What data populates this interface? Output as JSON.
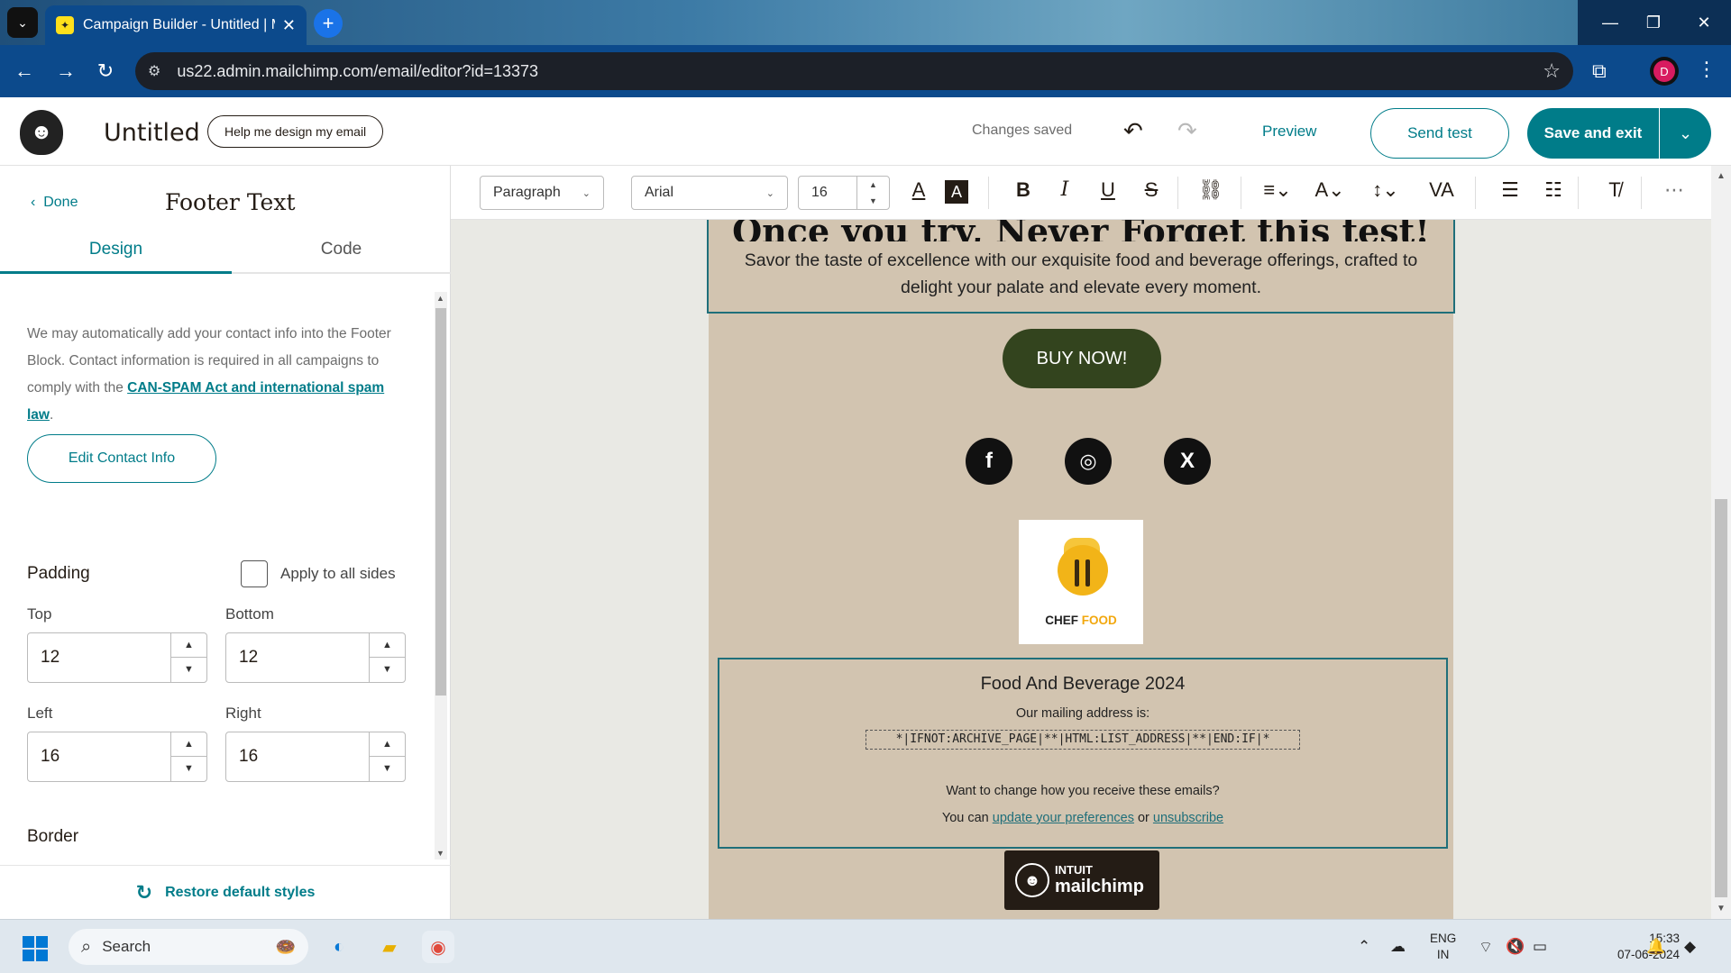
{
  "browser": {
    "tab_title": "Campaign Builder - Untitled | M",
    "favicon": "mailchimp-icon",
    "url": "us22.admin.mailchimp.com/email/editor?id=13373",
    "profile_initial": "D"
  },
  "header": {
    "campaign_title": "Untitled",
    "help_button": "Help me design my email",
    "status": "Changes saved",
    "preview": "Preview",
    "send_test": "Send test",
    "save_exit": "Save and exit"
  },
  "panel": {
    "done": "Done",
    "title": "Footer Text",
    "tabs": [
      {
        "label": "Design",
        "active": true
      },
      {
        "label": "Code",
        "active": false
      }
    ],
    "note_text": "We may automatically add your contact info into the Footer Block. Contact information is required in all campaigns to comply with the ",
    "note_link": "CAN-SPAM Act and international spam law",
    "note_end": ".",
    "edit_contact": "Edit Contact Info",
    "padding_heading": "Padding",
    "apply_all": "Apply to all sides",
    "apply_all_checked": false,
    "padding": {
      "top_label": "Top",
      "top": "12",
      "bottom_label": "Bottom",
      "bottom": "12",
      "left_label": "Left",
      "left": "16",
      "right_label": "Right",
      "right": "16"
    },
    "border_heading": "Border",
    "restore": "Restore default styles"
  },
  "format_bar": {
    "block_type": "Paragraph",
    "font": "Arial",
    "size": "16",
    "buttons": [
      "text-color-icon",
      "highlight-icon",
      "bold-icon",
      "italic-icon",
      "underline-icon",
      "strikethrough-icon",
      "link-icon",
      "align-icon",
      "text-style-icon",
      "line-height-icon",
      "letter-spacing-icon",
      "bullet-list-icon",
      "numbered-list-icon",
      "clear-format-icon",
      "more-icon"
    ]
  },
  "email": {
    "hero_title": "Once you try, Never Forget this test!",
    "hero_body": "Savor the taste of excellence with our exquisite food and beverage offerings, crafted to delight your palate and elevate every moment.",
    "cta": "BUY NOW!",
    "social": [
      "facebook-icon",
      "instagram-icon",
      "x-icon"
    ],
    "logo_text_1": "CHEF",
    "logo_text_2": "FOOD",
    "footer_title": "Food And Beverage 2024",
    "mailing_label": "Our mailing address is:",
    "merge_tag": "*|IFNOT:ARCHIVE_PAGE|**|HTML:LIST_ADDRESS|**|END:IF|*",
    "change_q": "Want to change how you receive these emails?",
    "you_can": "You can ",
    "update_link": "update your preferences",
    "or": " or ",
    "unsubscribe_link": "unsubscribe",
    "badge_line1": "INTUIT",
    "badge_line2": "mailchimp"
  },
  "taskbar": {
    "search": "Search",
    "lang_1": "ENG",
    "lang_2": "IN",
    "time": "15:33",
    "date": "07-06-2024"
  },
  "colors": {
    "accent": "#007c89",
    "email_bg": "#d2c4b0",
    "cta_bg": "#33441e"
  }
}
